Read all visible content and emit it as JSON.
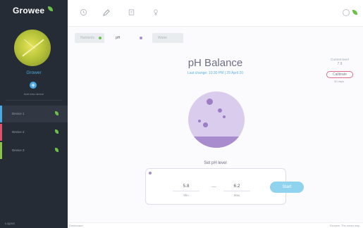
{
  "app": {
    "brand": "Growee"
  },
  "sidebar": {
    "profile_name": "Grower",
    "add_device_label": "Add new device",
    "devices": [
      {
        "label": "Device 1",
        "color": "#4aa9e0",
        "active": true
      },
      {
        "label": "Device 2",
        "color": "#e0506a",
        "active": false
      },
      {
        "label": "Device 3",
        "color": "#8bc34a",
        "active": false
      }
    ],
    "logout_label": "Logout"
  },
  "topbar": {
    "icons": [
      "clock-icon",
      "pencil-icon",
      "book-icon",
      "bulb-icon"
    ],
    "right_icons": [
      "gear-icon",
      "leaf-icon"
    ]
  },
  "tabs": [
    {
      "label": "Nutrients",
      "dot_color": "#6cc04a",
      "state": "off"
    },
    {
      "label": "pH",
      "dot_color": "#a98ccd",
      "state": "on"
    },
    {
      "label": "Water",
      "dot_color": "",
      "state": "off"
    }
  ],
  "main": {
    "title": "pH Balance",
    "last_change": "Last change: 10:30 PM | 25 April 20",
    "current_label": "Current level",
    "current_value": "7.9",
    "calibrate_label": "Calibrate",
    "calibrate_note": "30 days",
    "set_label": "Set pH level",
    "min_value": "5.8",
    "min_label": "Min",
    "dash": "—",
    "max_value": "6.2",
    "max_label": "Max",
    "start_label": "Start"
  },
  "footer": {
    "left": "Dashboard",
    "right": "Growee. The smart way."
  }
}
